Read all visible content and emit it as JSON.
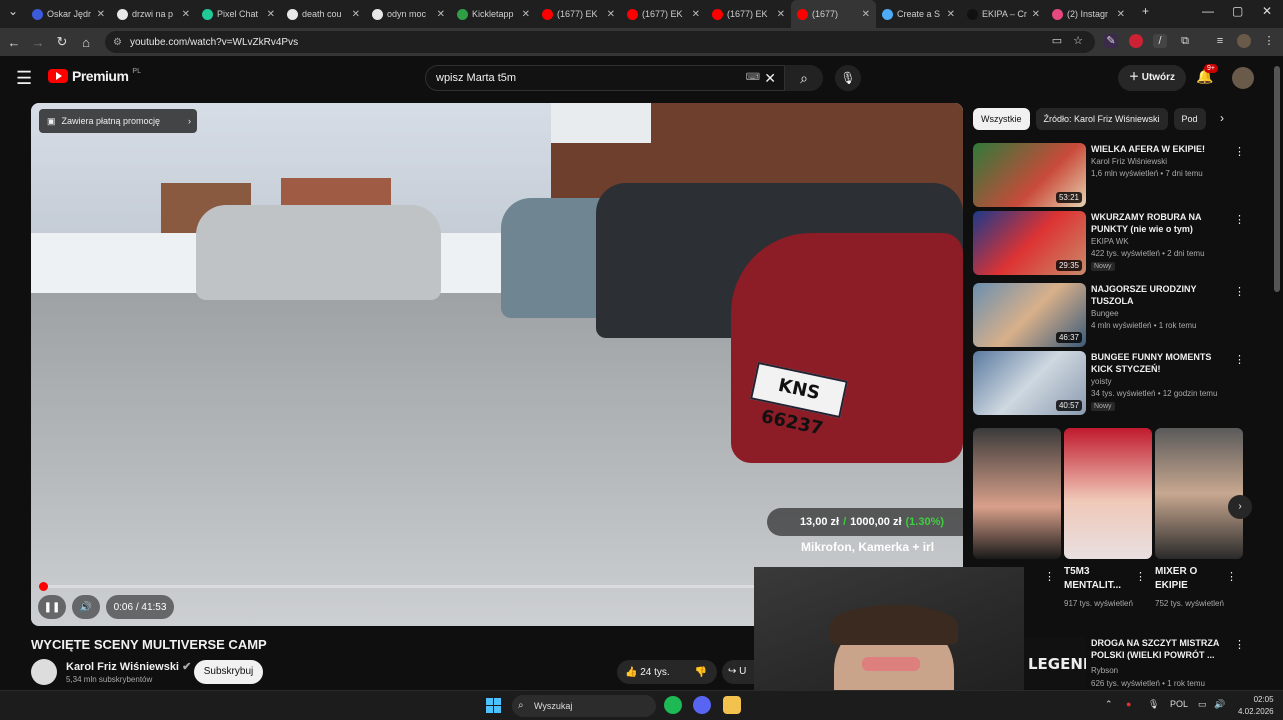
{
  "browser": {
    "tabs": [
      {
        "title": "Oskar Jędr",
        "color": "#3b5bdb"
      },
      {
        "title": "drzwi na p",
        "color": "#e8e8e8"
      },
      {
        "title": "Pixel Chat",
        "color": "#20c997"
      },
      {
        "title": "death cou",
        "color": "#e8e8e8"
      },
      {
        "title": "odyn moc",
        "color": "#e8e8e8"
      },
      {
        "title": "Kickletapp",
        "color": "#2f9e44"
      },
      {
        "title": "(1677) EK",
        "color": "#ff0000"
      },
      {
        "title": "(1677) EK",
        "color": "#ff0000"
      },
      {
        "title": "(1677) EK",
        "color": "#ff0000"
      },
      {
        "title": "(1677)",
        "color": "#ff0000"
      },
      {
        "title": "Create a S",
        "color": "#4dabf7"
      },
      {
        "title": "EKIPA – Cr",
        "color": "#111111"
      },
      {
        "title": "(2) Instagr",
        "color": "#e64980"
      }
    ],
    "url": "youtube.com/watch?v=WLvZkRv4Pvs"
  },
  "youtube": {
    "logo_text": "Premium",
    "logo_region": "PL",
    "search_value": "wpisz Marta t5m",
    "create_label": "Utwórz",
    "notif_badge": "9+"
  },
  "player": {
    "promo_label": "Zawiera płatną promocję",
    "donation": {
      "current": "13,00 zł",
      "sep": "/",
      "goal": "1000,00 zł",
      "percent": "(1.30%)"
    },
    "overlay_note": "Mikrofon, Kamerka + irl",
    "time": "0:06 / 41:53",
    "progress": 0.0024
  },
  "video": {
    "title": "WYCIĘTE SCENY MULTIVERSE CAMP",
    "channel": "Karol Friz Wiśniewski",
    "subscribers": "5,34 mln subskrybentów",
    "subscribe_label": "Subskrybuj",
    "likes": "24 tys.",
    "share_label": "U"
  },
  "sidebar": {
    "chips": [
      "Wszystkie",
      "Źródło: Karol Friz Wiśniewski",
      "Pod"
    ],
    "recs": [
      {
        "title": "WIELKA AFERA W EKIPIE!",
        "channel": "Karol Friz Wiśniewski",
        "meta": "1,6 mln wyświetleń • 7 dni temu",
        "duration": "53:21",
        "isNew": ""
      },
      {
        "title": "WKURZAMY ROBURA NA PUNKTY (nie wie o tym)",
        "channel": "EKIPA WK",
        "meta": "422 tys. wyświetleń • 2 dni temu",
        "duration": "29:35",
        "isNew": "Nowy"
      },
      {
        "title": "NAJGORSZE URODZINY TUSZOLA",
        "channel": "Bungee",
        "meta": "4 mln wyświetleń • 1 rok temu",
        "duration": "46:37",
        "isNew": ""
      },
      {
        "title": "BUNGEE FUNNY MOMENTS KICK STYCZEŃ!",
        "channel": "yoisty",
        "meta": "34 tys. wyświetleń • 12 godzin temu",
        "duration": "40:57",
        "isNew": "Nowy"
      }
    ],
    "shorts": [
      {
        "title": "",
        "meta": ""
      },
      {
        "title": "T5M3 MENTALIT...",
        "meta": "917 tys. wyświetleń"
      },
      {
        "title": "MIXER O EKIPIE",
        "meta": "752 tys. wyświetleń"
      }
    ],
    "bottom_rec": {
      "title": "DROGA NA SZCZYT MISTRZA POLSKI (WIELKI POWRÓT ...",
      "channel": "Rybson",
      "meta": "626 tys. wyświetleń • 1 rok temu",
      "thumb_text": "LEGENDY"
    }
  },
  "taskbar": {
    "search_placeholder": "Wyszukaj",
    "lang": "POL",
    "time": "02:05",
    "date": "4.02.2026"
  }
}
